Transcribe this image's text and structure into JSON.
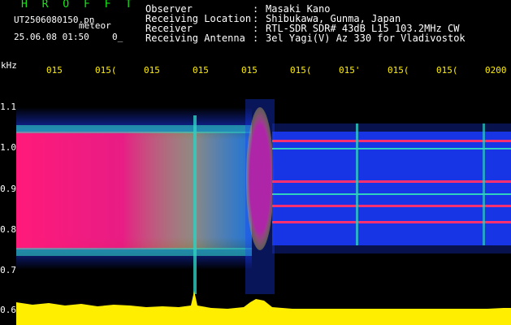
{
  "header": {
    "brand": "H R O F F T",
    "filename": "UT2506080150.pn",
    "tag": "meteor",
    "datetime": "25.06.08 01:50",
    "count": "0_"
  },
  "meta": [
    {
      "label": "Observer",
      "sep": ":",
      "value": "Masaki Kano"
    },
    {
      "label": "Receiving Location",
      "sep": ":",
      "value": "Shibukawa, Gunma, Japan"
    },
    {
      "label": "Receiver",
      "sep": ":",
      "value": "RTL-SDR SDR# 43dB L15 103.2MHz CW"
    },
    {
      "label": "Receiving Antenna",
      "sep": ":",
      "value": "3el Yagi(V) Az 330 for Vladivostok"
    }
  ],
  "axis": {
    "unit": "kHz",
    "y_labels": [
      "1.1",
      "1.0",
      "0.9",
      "0.8",
      "0.7",
      "0.6"
    ],
    "time_ticks": [
      "015",
      "015(",
      "015",
      "015",
      "015",
      "015(",
      "015'",
      "015(",
      "015(",
      "0200"
    ]
  },
  "colors": {
    "background": "#000000",
    "brand": "#19e619",
    "ticks": "#ffee00",
    "strong_signal": "#ff1a7a",
    "noise_band": "#1a3cff"
  }
}
